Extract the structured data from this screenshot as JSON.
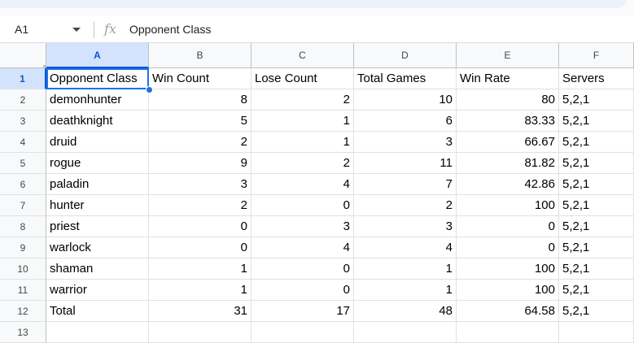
{
  "name_box": {
    "value": "A1"
  },
  "formula_bar": {
    "icon": "fx-icon",
    "content": "Opponent Class"
  },
  "columns": [
    "A",
    "B",
    "C",
    "D",
    "E",
    "F"
  ],
  "rows": [
    "1",
    "2",
    "3",
    "4",
    "5",
    "6",
    "7",
    "8",
    "9",
    "10",
    "11",
    "12",
    "13"
  ],
  "active_cell": "A1",
  "table": {
    "header": [
      "Opponent Class",
      "Win Count",
      "Lose Count",
      "Total Games",
      "Win Rate",
      "Servers"
    ],
    "body": [
      [
        "demonhunter",
        "8",
        "2",
        "10",
        "80",
        "5,2,1"
      ],
      [
        "deathknight",
        "5",
        "1",
        "6",
        "83.33",
        "5,2,1"
      ],
      [
        "druid",
        "2",
        "1",
        "3",
        "66.67",
        "5,2,1"
      ],
      [
        "rogue",
        "9",
        "2",
        "11",
        "81.82",
        "5,2,1"
      ],
      [
        "paladin",
        "3",
        "4",
        "7",
        "42.86",
        "5,2,1"
      ],
      [
        "hunter",
        "2",
        "0",
        "2",
        "100",
        "5,2,1"
      ],
      [
        "priest",
        "0",
        "3",
        "3",
        "0",
        "5,2,1"
      ],
      [
        "warlock",
        "0",
        "4",
        "4",
        "0",
        "5,2,1"
      ],
      [
        "shaman",
        "1",
        "0",
        "1",
        "100",
        "5,2,1"
      ],
      [
        "warrior",
        "1",
        "0",
        "1",
        "100",
        "5,2,1"
      ],
      [
        "Total",
        "31",
        "17",
        "48",
        "64.58",
        "5,2,1"
      ]
    ]
  }
}
